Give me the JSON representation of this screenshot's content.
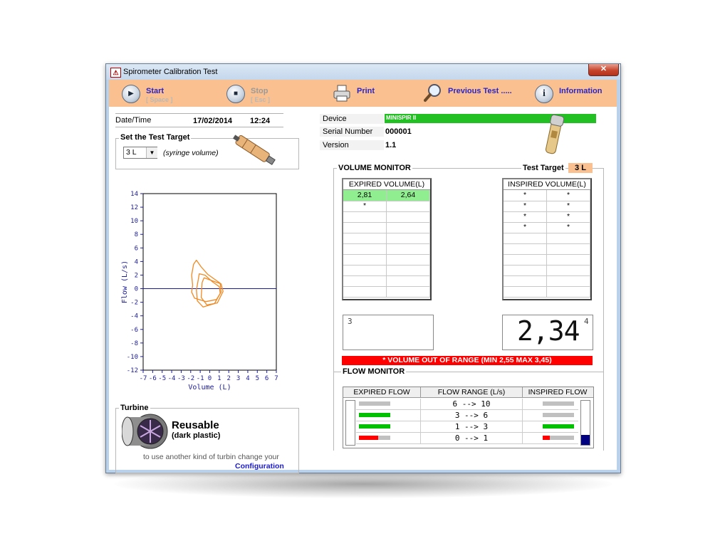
{
  "window": {
    "title": "Spirometer Calibration Test",
    "close_glyph": "✕"
  },
  "toolbar": {
    "start": {
      "label": "Start",
      "sub": "[ Space ]"
    },
    "stop": {
      "label": "Stop",
      "sub": "[ Esc ]"
    },
    "print": {
      "label": "Print"
    },
    "previous": {
      "label": "Previous Test ....."
    },
    "info": {
      "label": "Information"
    }
  },
  "datetime": {
    "label": "Date/Time",
    "date": "17/02/2014",
    "time": "12:24"
  },
  "target": {
    "title": "Set the Test Target",
    "selected": "3 L",
    "note": "(syringe volume)"
  },
  "device": {
    "device_label": "Device",
    "device_value": "MINISPIR II",
    "serial_label": "Serial Number",
    "serial_value": "000001",
    "version_label": "Version",
    "version_value": "1.1",
    "accent": "#22c022"
  },
  "chart_data": {
    "type": "line",
    "xlabel": "Volume (L)",
    "ylabel": "Flow (L/s)",
    "xlim": [
      -7,
      7
    ],
    "ylim": [
      -12,
      14
    ],
    "x_ticks": [
      -7,
      -6,
      -5,
      -4,
      -3,
      -2,
      -1,
      0,
      1,
      2,
      3,
      4,
      5,
      6,
      7
    ],
    "y_ticks": [
      14,
      12,
      10,
      8,
      6,
      4,
      2,
      0,
      -2,
      -4,
      -6,
      -8,
      -10,
      -12
    ],
    "series": [
      {
        "color": "#f08a24",
        "loops": [
          [
            [
              -1.8,
              0.5
            ],
            [
              -1.9,
              2
            ],
            [
              -1.7,
              3.6
            ],
            [
              -1.4,
              4.2
            ],
            [
              -0.9,
              3.2
            ],
            [
              -0.2,
              2.1
            ],
            [
              0.6,
              1.3
            ],
            [
              1.1,
              0.8
            ],
            [
              1.2,
              -0.5
            ],
            [
              0.7,
              -1.6
            ],
            [
              -0.4,
              -1.9
            ],
            [
              -1.6,
              -1.4
            ],
            [
              -1.9,
              -0.5
            ],
            [
              -1.8,
              0.5
            ]
          ],
          [
            [
              -1.2,
              1.4
            ],
            [
              -1.1,
              2.2
            ],
            [
              -0.5,
              2.0
            ],
            [
              0.3,
              1.0
            ],
            [
              1.0,
              0.3
            ],
            [
              1.1,
              -0.7
            ],
            [
              0.5,
              -2.2
            ],
            [
              -0.7,
              -2.7
            ],
            [
              -1.3,
              -1.8
            ],
            [
              -1.4,
              -0.2
            ],
            [
              -1.2,
              1.4
            ]
          ],
          [
            [
              -0.8,
              0.9
            ],
            [
              -0.6,
              1.6
            ],
            [
              0.2,
              1.2
            ],
            [
              1.2,
              0.7
            ],
            [
              1.4,
              -0.4
            ],
            [
              0.8,
              -2.1
            ],
            [
              -0.3,
              -2.4
            ],
            [
              -0.9,
              -1.3
            ],
            [
              -0.8,
              0.9
            ]
          ]
        ]
      }
    ]
  },
  "volume_monitor": {
    "title": "VOLUME MONITOR",
    "target_label": "Test Target",
    "target_value": "3 L",
    "expired_header": "EXPIRED VOLUME(L)",
    "expired_rows": [
      [
        "2,81",
        "2,64"
      ],
      [
        "*",
        ""
      ],
      [
        "",
        ""
      ],
      [
        "",
        ""
      ],
      [
        "",
        ""
      ],
      [
        "",
        ""
      ],
      [
        "",
        ""
      ],
      [
        "",
        ""
      ],
      [
        "",
        ""
      ],
      [
        "",
        ""
      ]
    ],
    "inspired_header": "INSPIRED VOLUME(L)",
    "inspired_rows": [
      [
        "*",
        "*"
      ],
      [
        "*",
        "*"
      ],
      [
        "*",
        "*"
      ],
      [
        "*",
        "*"
      ],
      [
        "",
        ""
      ],
      [
        "",
        ""
      ],
      [
        "",
        ""
      ],
      [
        "",
        ""
      ],
      [
        "",
        ""
      ],
      [
        "",
        ""
      ]
    ],
    "left_lcd_index": "3",
    "right_lcd_index": "4",
    "right_lcd_value": "2,34",
    "warning": "*  VOLUME  OUT OF RANGE (MIN 2,55 MAX 3,45)"
  },
  "flow_monitor": {
    "title": "FLOW MONITOR",
    "headers": {
      "expired": "EXPIRED FLOW",
      "range": "FLOW RANGE (L/s)",
      "inspired": "INSPIRED FLOW"
    },
    "rows": [
      {
        "range": "6 --> 10",
        "expired_fill": 0.0,
        "expired_color": "#c0c0c0",
        "inspired_fill": 0.0,
        "inspired_color": "#c0c0c0"
      },
      {
        "range": "3 --> 6",
        "expired_fill": 1.0,
        "expired_color": "#00c000",
        "inspired_fill": 0.0,
        "inspired_color": "#c0c0c0"
      },
      {
        "range": "1 --> 3",
        "expired_fill": 1.0,
        "expired_color": "#00c000",
        "inspired_fill": 1.0,
        "inspired_color": "#00c000"
      },
      {
        "range": "0 --> 1",
        "expired_fill": 0.62,
        "expired_color": "#ff0000",
        "inspired_fill": 0.22,
        "inspired_color": "#ff0000"
      }
    ],
    "left_level": 0.0,
    "right_level": 0.22
  },
  "turbine": {
    "title": "Turbine",
    "type": "Reusable",
    "material": "(dark plastic)",
    "hint": "to use another kind of turbin change your",
    "link": "Configuration"
  }
}
